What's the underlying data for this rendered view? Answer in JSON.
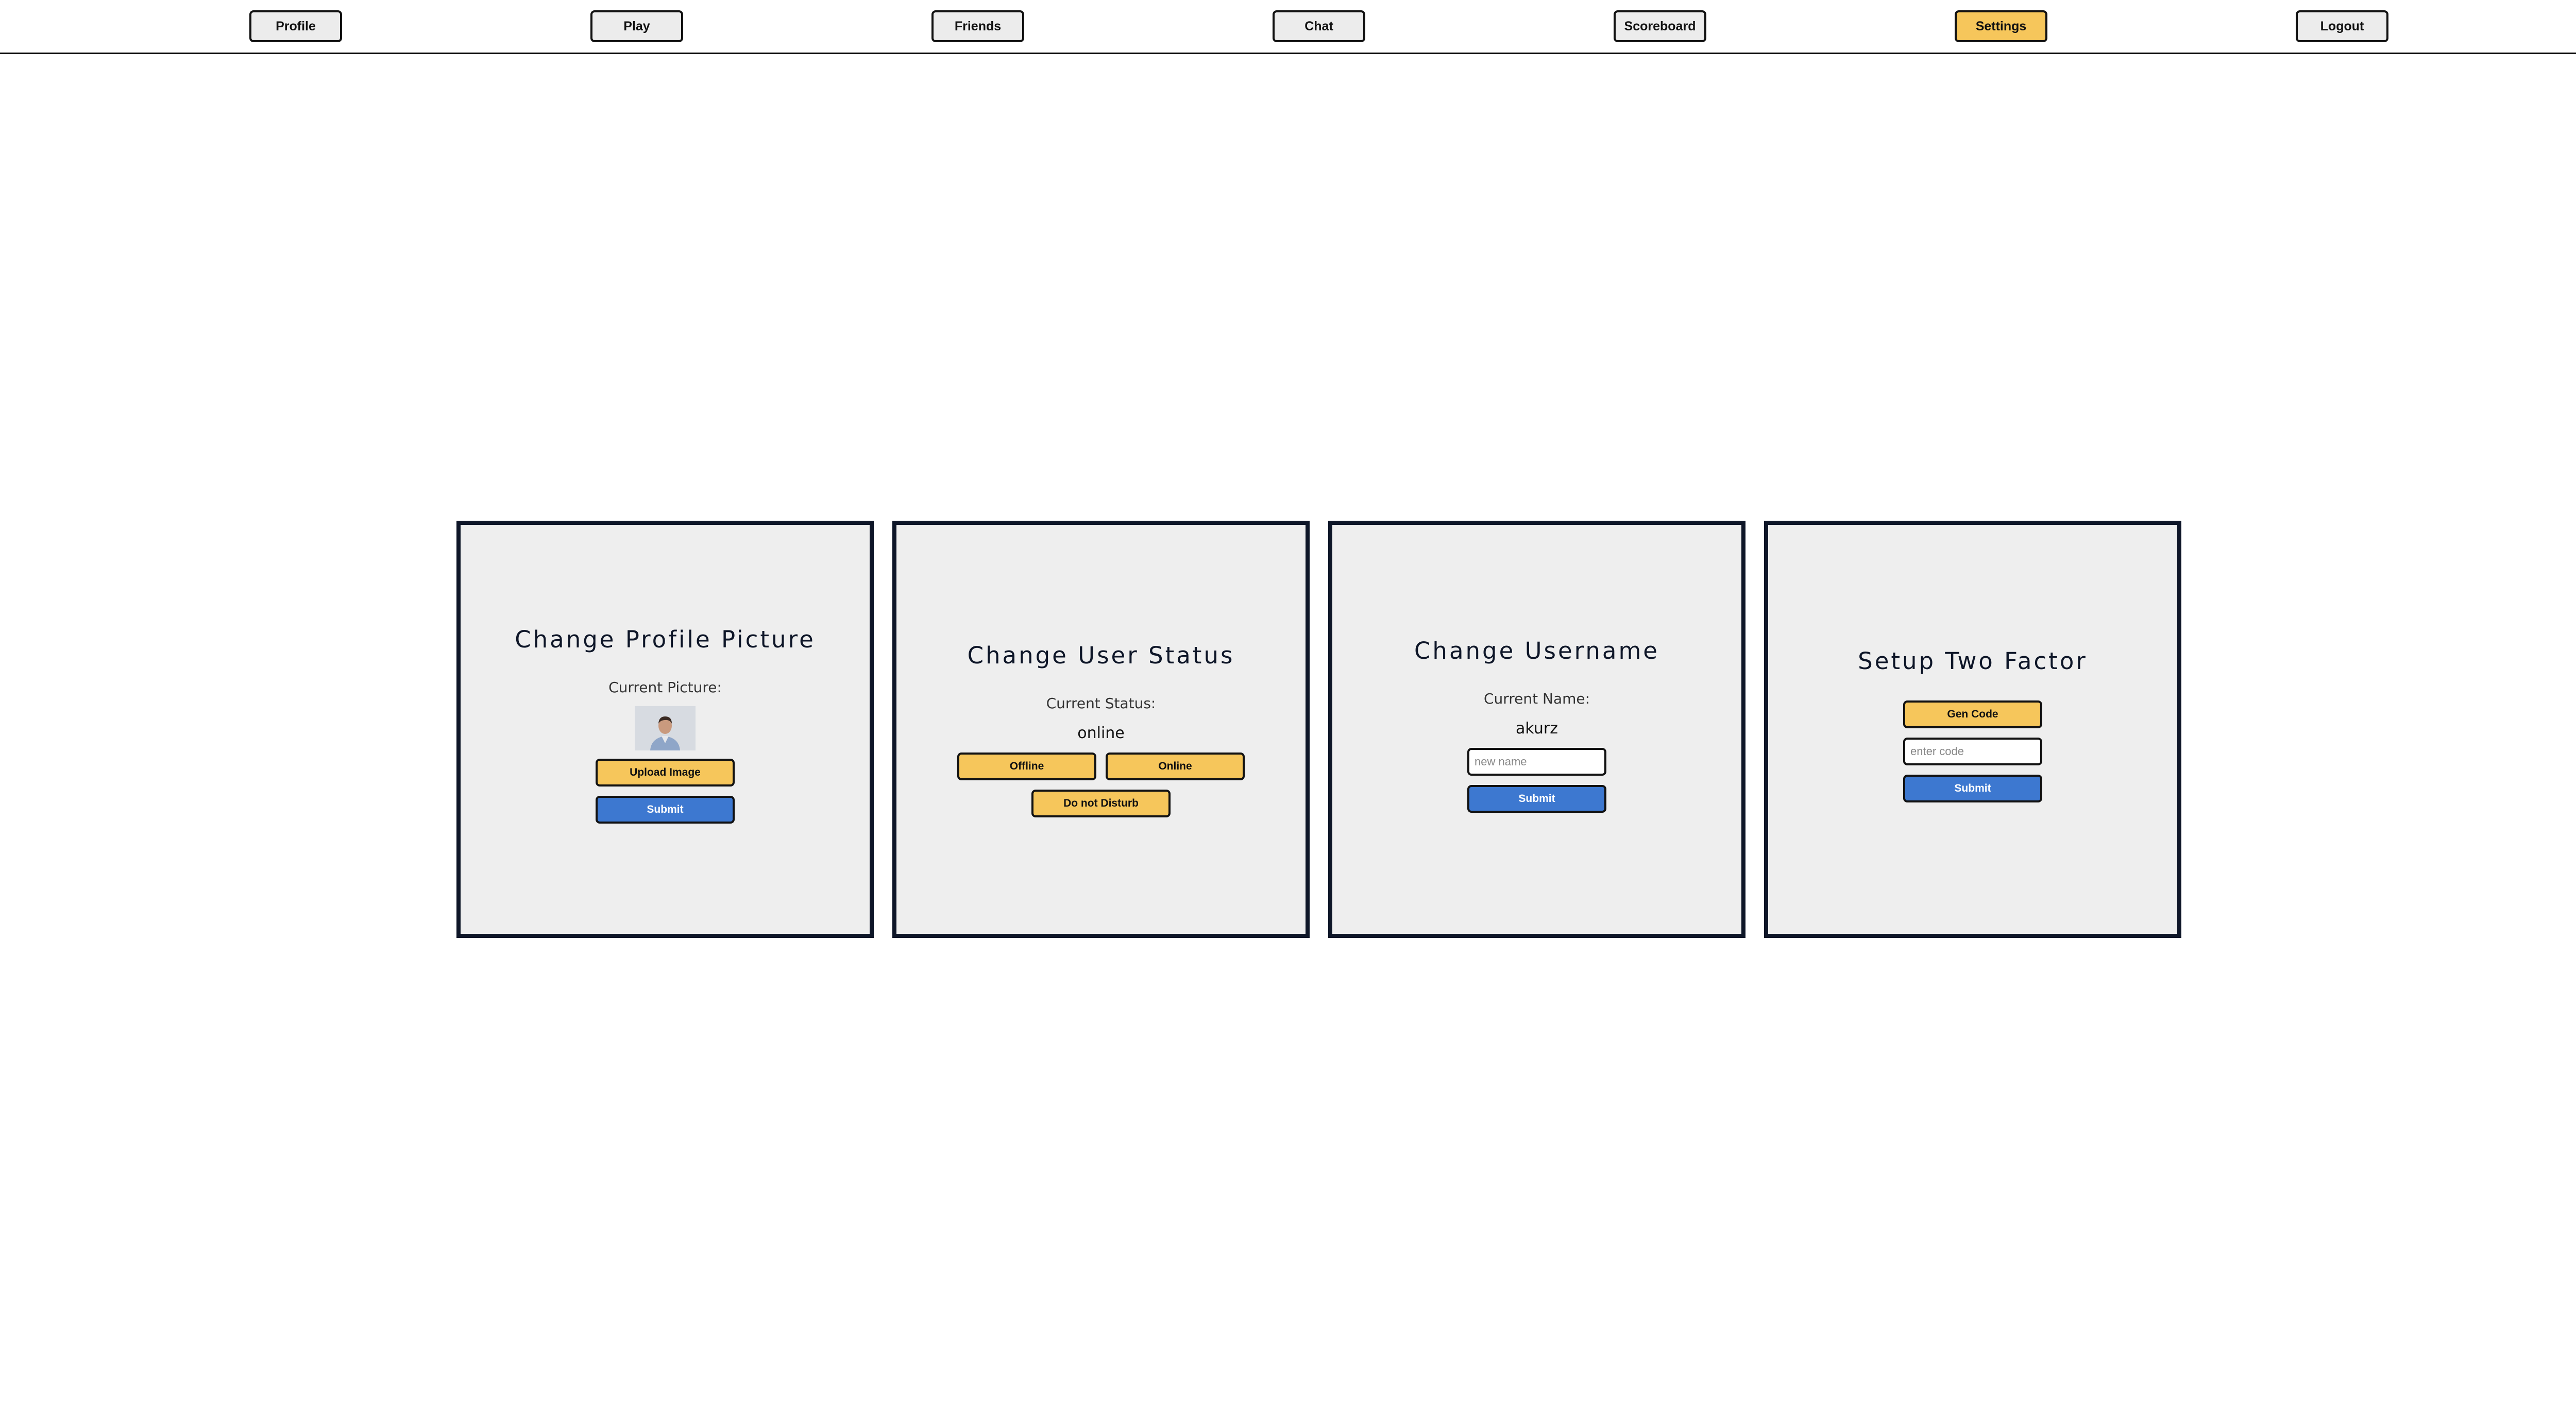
{
  "nav": {
    "profile": "Profile",
    "play": "Play",
    "friends": "Friends",
    "chat": "Chat",
    "scoreboard": "Scoreboard",
    "settings": "Settings",
    "logout": "Logout",
    "active": "Settings"
  },
  "picture_card": {
    "title": "Change Profile Picture",
    "label": "Current Picture:",
    "upload_label": "Upload Image",
    "submit_label": "Submit"
  },
  "status_card": {
    "title": "Change User Status",
    "label": "Current Status:",
    "value": "online",
    "offline_label": "Offline",
    "online_label": "Online",
    "dnd_label": "Do not Disturb"
  },
  "username_card": {
    "title": "Change Username",
    "label": "Current Name:",
    "value": "akurz",
    "placeholder": "new name",
    "submit_label": "Submit"
  },
  "twofactor_card": {
    "title": "Setup Two Factor",
    "gen_label": "Gen Code",
    "placeholder": "enter code",
    "submit_label": "Submit"
  },
  "colors": {
    "accent_yellow": "#f6c65b",
    "accent_blue": "#3d78d0",
    "card_border": "#0e1628",
    "card_bg": "#eeeeee"
  }
}
